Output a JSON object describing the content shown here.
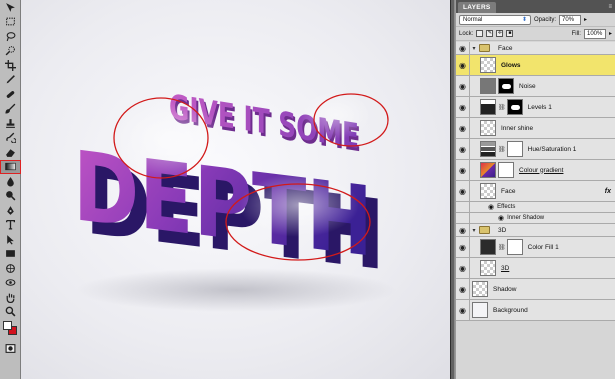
{
  "layers_panel": {
    "tab_label": "LAYERS",
    "blend_mode": "Normal",
    "opacity_label": "Opacity:",
    "opacity_value": "70%",
    "lock_label": "Lock:",
    "fill_label": "Fill:",
    "fill_value": "100%",
    "layers": [
      {
        "name": "Face",
        "kind": "group"
      },
      {
        "name": "Glows",
        "kind": "layer",
        "selected": true
      },
      {
        "name": "Noise",
        "kind": "layer"
      },
      {
        "name": "Levels 1",
        "kind": "adjustment"
      },
      {
        "name": "Inner shine",
        "kind": "layer"
      },
      {
        "name": "Hue/Saturation 1",
        "kind": "adjustment"
      },
      {
        "name": "Colour gradient",
        "kind": "layer"
      },
      {
        "name": "Face",
        "kind": "layer",
        "fx": "fx"
      },
      {
        "name": "Effects",
        "kind": "effects"
      },
      {
        "name": "Inner Shadow",
        "kind": "effect"
      },
      {
        "name": "3D",
        "kind": "group"
      },
      {
        "name": "Color Fill 1",
        "kind": "fill"
      },
      {
        "name": "3D",
        "kind": "layer"
      },
      {
        "name": "Shadow",
        "kind": "layer"
      },
      {
        "name": "Background",
        "kind": "layer"
      }
    ]
  },
  "artwork": {
    "headline_top": "GIVE IT SOME",
    "headline_main": "DEPTH",
    "annotation_color": "#d21a1a",
    "text_colors": [
      "#b04ab8",
      "#6a2aa8",
      "#3b1f8a"
    ]
  },
  "toolbar": {
    "selected_tool": "gradient-tool",
    "foreground_color": "#ffffff",
    "background_color": "#d1121e"
  }
}
